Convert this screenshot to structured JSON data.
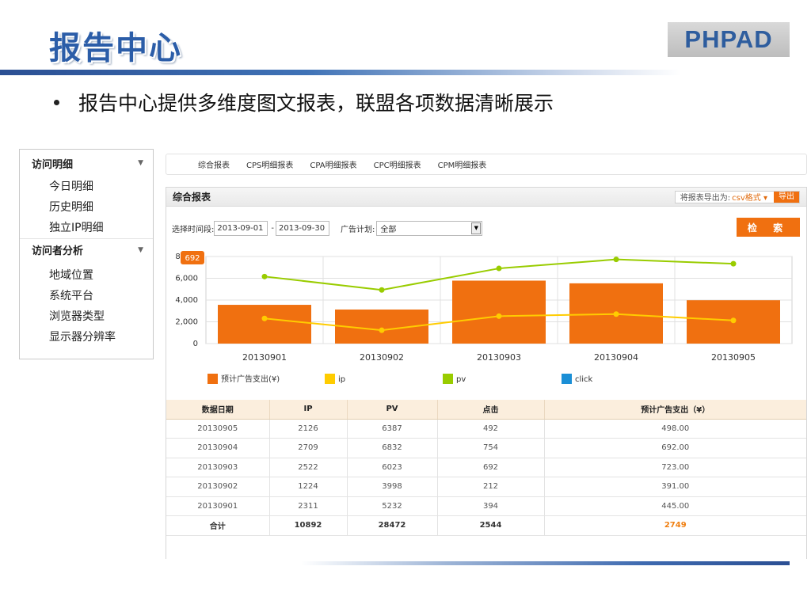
{
  "slide": {
    "title": "报告中心",
    "logo": "PHPAD",
    "bullet": "报告中心提供多维度图文报表，联盟各项数据清晰展示"
  },
  "sidebar": {
    "sections": [
      {
        "label": "访问明细",
        "items": [
          "今日明细",
          "历史明细",
          "独立IP明细"
        ]
      },
      {
        "label": "访问者分析",
        "items": [
          "地域位置",
          "系统平台",
          "浏览器类型",
          "显示器分辨率"
        ]
      }
    ]
  },
  "tabs": [
    "综合报表",
    "CPS明细报表",
    "CPA明细报表",
    "CPC明细报表",
    "CPM明细报表"
  ],
  "panel": {
    "title": "综合报表",
    "export_label": "将报表导出为:",
    "export_format": "csv格式",
    "export_button": "导出"
  },
  "filters": {
    "time_label": "选择时间段:",
    "start_date": "2013-09-01",
    "end_date": "2013-09-30",
    "plan_label": "广告计划:",
    "plan_value": "全部",
    "search_button": "检 索"
  },
  "chart_data": {
    "type": "bar",
    "categories": [
      "20130901",
      "20130902",
      "20130903",
      "20130904",
      "20130905"
    ],
    "series": [
      {
        "name": "预计广告支出(¥)",
        "kind": "bar",
        "color": "#f07010",
        "values": [
          445,
          391,
          723,
          692,
          498
        ]
      },
      {
        "name": "ip",
        "kind": "line",
        "color": "#ffcc00",
        "values": [
          2311,
          1224,
          2522,
          2709,
          2126
        ]
      },
      {
        "name": "pv",
        "kind": "line",
        "color": "#99cc00",
        "values": [
          6159,
          4929,
          6905,
          7732,
          7335
        ]
      },
      {
        "name": "click",
        "kind": "line",
        "color": "#1b8fd6",
        "values": []
      }
    ],
    "yticks": [
      "8,000",
      "6,000",
      "4,000",
      "2,000",
      "0"
    ],
    "ylim": [
      0,
      8000
    ],
    "tooltip": "692",
    "grid": true,
    "legend": "bottom"
  },
  "table": {
    "headers": [
      "数据日期",
      "IP",
      "PV",
      "点击",
      "预计广告支出（¥）"
    ],
    "rows": [
      [
        "20130905",
        "2126",
        "6387",
        "492",
        "498.00"
      ],
      [
        "20130904",
        "2709",
        "6832",
        "754",
        "692.00"
      ],
      [
        "20130903",
        "2522",
        "6023",
        "692",
        "723.00"
      ],
      [
        "20130902",
        "1224",
        "3998",
        "212",
        "391.00"
      ],
      [
        "20130901",
        "2311",
        "5232",
        "394",
        "445.00"
      ]
    ],
    "total": [
      "合计",
      "10892",
      "28472",
      "2544",
      "2749"
    ]
  },
  "colors": {
    "brand": "#2b5da8",
    "accent": "#f07010"
  }
}
